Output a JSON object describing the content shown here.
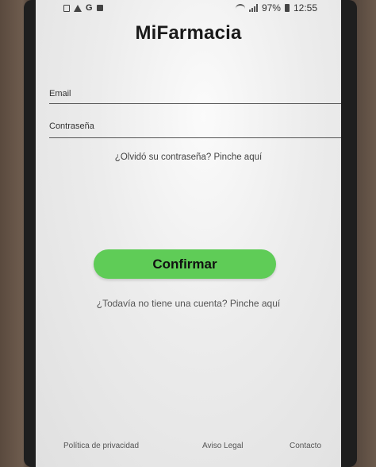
{
  "status_bar": {
    "battery_percent": "97%",
    "time": "12:55",
    "notification_icons": [
      "image-icon",
      "warning-icon",
      "google-icon",
      "bag-icon"
    ]
  },
  "app": {
    "title": "MiFarmacia"
  },
  "login_form": {
    "email_label": "Email",
    "password_label": "Contraseña",
    "forgot_password_link": "¿Olvidó su contraseña? Pinche aquí",
    "confirm_button": "Confirmar",
    "register_link": "¿Todavía no tiene una cuenta? Pinche aquí"
  },
  "footer": {
    "privacy": "Política de privacidad",
    "legal": "Aviso Legal",
    "contact": "Contacto"
  },
  "colors": {
    "confirm_button_bg": "#5fcc57",
    "screen_bg": "#ececec"
  }
}
